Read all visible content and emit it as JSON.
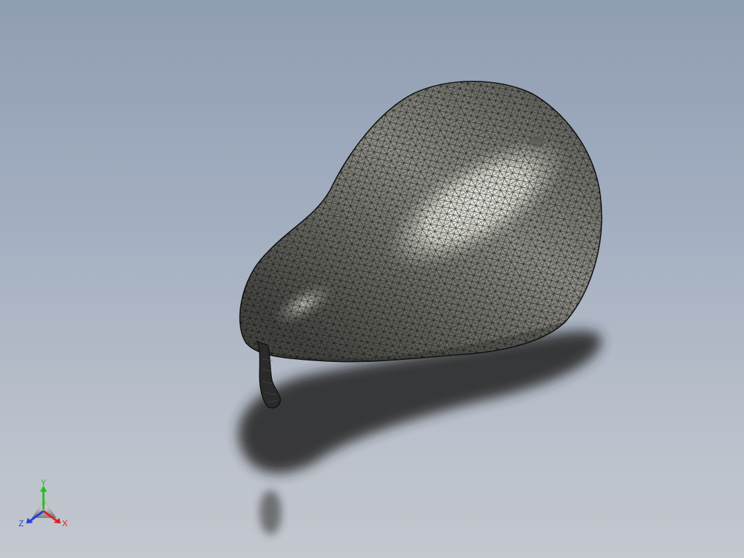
{
  "viewport": {
    "background_top": "#8f9db3",
    "background_bottom": "#c3c7ce",
    "model_shading": "shaded-with-edges"
  },
  "model": {
    "object": "pear",
    "body_color": "#8c8c86",
    "highlight_color": "#f4f4ec",
    "mesh_color": "#1a1a1a",
    "stem_color": "#2a2a2a"
  },
  "triad": {
    "x_label": "X",
    "y_label": "Y",
    "z_label": "Z",
    "x_color": "#e02020",
    "y_color": "#20c020",
    "z_color": "#2040e0"
  }
}
